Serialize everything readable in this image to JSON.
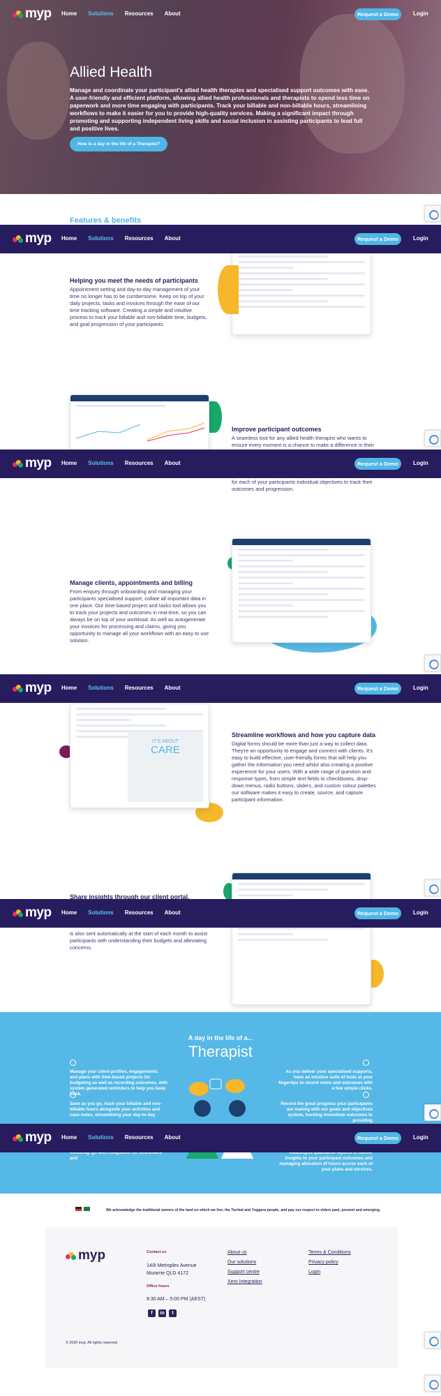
{
  "nav": {
    "logo_text": "myp",
    "links": [
      "Home",
      "Solutions",
      "Resources",
      "About"
    ],
    "active_link": "Solutions",
    "demo_button": "Request a Demo",
    "login": "Login"
  },
  "hero": {
    "title": "Allied Health",
    "lead": "Manage and coordinate your participant's allied health therapies and specialised support outcomes with ease. A user-friendly and efficient platform, allowing allied health professionals and therapists to spend less time on paperwork and more time engaging with participants. Track your billable and non-billable hours, streamlining workflows to make it easier for you to provide high-quality services. Making a significant impact through promoting and supporting independent living skills and social inclusion in assisting participants to lead full and positive lives.",
    "cta": "How is a day in the life of a Therapist?"
  },
  "features": {
    "heading": "Features & benefits",
    "items": [
      {
        "title": "Helping you meet the needs of participants",
        "text": "Appointment setting and day-to-day management of your time no longer has to be cumbersome. Keep on top of your daily projects, tasks and invoices through the ease of our time tracking software. Creating a simple and intuitive process to track your billable and non-billable time, budgets, and goal progression of your participants."
      },
      {
        "title": "Improve participant outcomes",
        "text_top": "A seamless tool for any allied health therapist who wants to ensure every moment is a chance to make a difference in their",
        "text_bottom": "for each of your participants individual objectives to track their outcomes and progression."
      },
      {
        "title": "Manage clients, appointments and billing",
        "text": "From enquiry through onboarding and managing your participants specialised support, collate all important data in one place. Our time-based project and tasks tool allows you to track your projects and outcomes in real-time, so you can always be on top of your workload. As well as autogenerate your invoices for processing and claims, giving you opportunity to manage all your workflows with an easy to use solution."
      },
      {
        "title": "Streamline workflows and how you capture data",
        "text": "Digital forms should be more than just a way to collect data. They're an opportunity to engage and connect with clients. It's easy to build effective, user-friendly forms that will help you gather the information you need whilst also creating a positive experience for your users. With a wide range of question and response types, from simple text fields to checkboxes, drop-down menus, radio buttons, sliders, and custom colour palettes our software makes it easy to create, source, and capture participant information.",
        "mock_heading": "IT'S ABOUT",
        "mock_big": "CARE"
      },
      {
        "title": "Share insights through our client portal.",
        "text": "is also sent automatically at the start of each month to assist participants with understanding their budgets and alleviating concerns."
      }
    ]
  },
  "therapist": {
    "pre": "A day in the life of a...",
    "title": "Therapist",
    "left_1": "Manage your client profiles, engagements, and plans with time-based projects for budgeting as well as recording outcomes, with system generated reminders to help you keep track.",
    "left_2": "Save as you go, track your billable and non-billable hours alongside your activities and case notes, streamlining your day-to-day",
    "left_3": "invoicing. go with integration for timesheets and",
    "right_1": "As you deliver your specialised supports, have an intuitive suite of tools at your fingertips to record notes and outcomes with a few simple clicks.",
    "right_2": "Record the great progress your participants are making with our goals and objectives system, tracking immediate outcomes to providing",
    "right_3": "meaningful qualitative reports to deliver insights to your participant outcomes and managing allocation of hours across each of your plans and services."
  },
  "acknowledgement": "We acknowledge the traditional owners of the land on which we live, the Turrbal and Yuggera people, and pay our respect to elders past, present and emerging.",
  "footer": {
    "logo_text": "myp",
    "contact_label": "Contact us",
    "address_1": "14/8 Metroplex Avenue",
    "address_2": "Murarrie QLD 4172",
    "hours_label": "Office hours",
    "hours": "8:30 AM – 5:00 PM (AEST)",
    "links_1": [
      "About us",
      "Our solutions",
      "Support centre",
      "Xero Integration"
    ],
    "links_2": [
      "Terms & Conditions",
      "Privacy policy",
      "Login"
    ],
    "copyright": "© 2020 myp. All rights reserved."
  },
  "colors": {
    "nav_bg": "#261c5e",
    "accent": "#4fb6e6",
    "brand_text": "#27245a"
  }
}
